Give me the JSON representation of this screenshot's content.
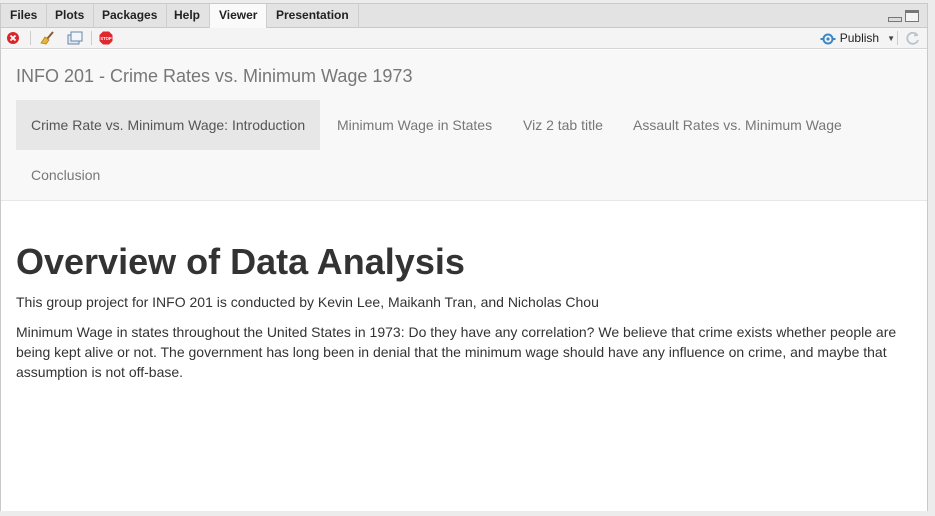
{
  "ide_tabs": [
    "Files",
    "Plots",
    "Packages",
    "Help",
    "Viewer",
    "Presentation"
  ],
  "active_ide_tab": "Viewer",
  "toolbar": {
    "publish_label": "Publish",
    "icons": [
      "remove-viewer-icon",
      "clear-broom-icon",
      "popout-window-icon",
      "stop-icon",
      "refresh-icon"
    ]
  },
  "app": {
    "title": "INFO 201 - Crime Rates vs. Minimum Wage 1973",
    "tabs": [
      "Crime Rate vs. Minimum Wage: Introduction",
      "Minimum Wage in States",
      "Viz 2 tab title",
      "Assault Rates vs. Minimum Wage",
      "Conclusion"
    ],
    "active_tab": "Crime Rate vs. Minimum Wage: Introduction"
  },
  "content": {
    "heading": "Overview of Data Analysis",
    "authors": "This group project for INFO 201 is conducted by Kevin Lee, Maikanh Tran, and Nicholas Chou",
    "paragraph": "Minimum Wage in states throughout the United States in 1973: Do they have any correlation? We believe that crime exists whether people are being kept alive or not. The government has long been in denial that the minimum wage should have any influence on crime, and maybe that assumption is not off-base."
  },
  "colors": {
    "navbar_bg": "#f8f8f8",
    "active_tab_bg": "#e7e7e7",
    "stop_red": "#e0282e",
    "publish_blue": "#3a87c8"
  }
}
